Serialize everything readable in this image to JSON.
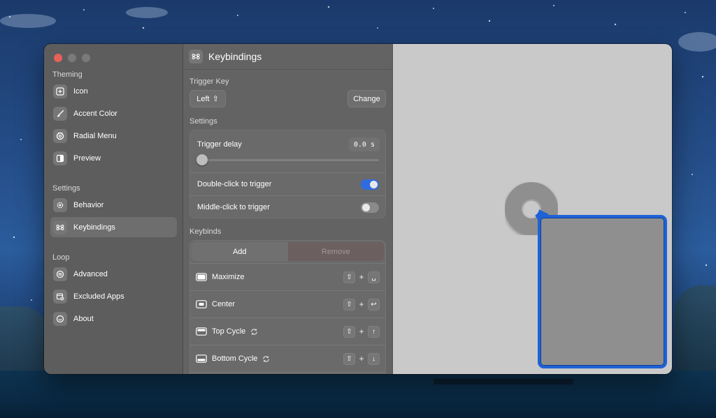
{
  "window": {
    "traffic_lights": [
      "close",
      "minimize",
      "zoom"
    ]
  },
  "sidebar": {
    "sections": [
      {
        "title": "Theming",
        "items": [
          {
            "label": "Icon",
            "icon": "plus-square-icon"
          },
          {
            "label": "Accent Color",
            "icon": "paintbrush-icon"
          },
          {
            "label": "Radial Menu",
            "icon": "circle-ring-icon"
          },
          {
            "label": "Preview",
            "icon": "sidebar-preview-icon"
          }
        ]
      },
      {
        "title": "Settings",
        "items": [
          {
            "label": "Behavior",
            "icon": "gear-icon"
          },
          {
            "label": "Keybindings",
            "icon": "command-icon",
            "active": true
          }
        ]
      },
      {
        "title": "Loop",
        "items": [
          {
            "label": "Advanced",
            "icon": "advanced-icon"
          },
          {
            "label": "Excluded Apps",
            "icon": "excluded-apps-icon"
          },
          {
            "label": "About",
            "icon": "about-icon"
          }
        ]
      }
    ]
  },
  "content": {
    "header_title": "Keybindings",
    "header_icon": "command-icon",
    "trigger_key": {
      "label": "Trigger Key",
      "value": "Left",
      "value_icon": "shift-icon",
      "change_label": "Change"
    },
    "settings": {
      "label": "Settings",
      "trigger_delay_label": "Trigger delay",
      "trigger_delay_value": "0.0 s",
      "trigger_delay_fraction": 0,
      "double_click_label": "Double-click to trigger",
      "double_click_on": true,
      "middle_click_label": "Middle-click to trigger",
      "middle_click_on": false
    },
    "keybinds": {
      "label": "Keybinds",
      "add_label": "Add",
      "remove_label": "Remove",
      "rows": [
        {
          "label": "Maximize",
          "icon": "maximize-icon",
          "cycle": false,
          "keys": [
            "⇧",
            "+",
            "␣"
          ]
        },
        {
          "label": "Center",
          "icon": "center-icon",
          "cycle": false,
          "keys": [
            "⇧",
            "+",
            "↩"
          ]
        },
        {
          "label": "Top Cycle",
          "icon": "top-half-icon",
          "cycle": true,
          "keys": [
            "⇧",
            "+",
            "↑"
          ]
        },
        {
          "label": "Bottom Cycle",
          "icon": "bottom-half-icon",
          "cycle": true,
          "keys": [
            "⇧",
            "+",
            "↓"
          ]
        }
      ]
    }
  },
  "preview": {
    "accent_color": "#1e62d6",
    "radial_menu_color": "#8f8f8f",
    "window_fill": "#8f8f8f"
  }
}
